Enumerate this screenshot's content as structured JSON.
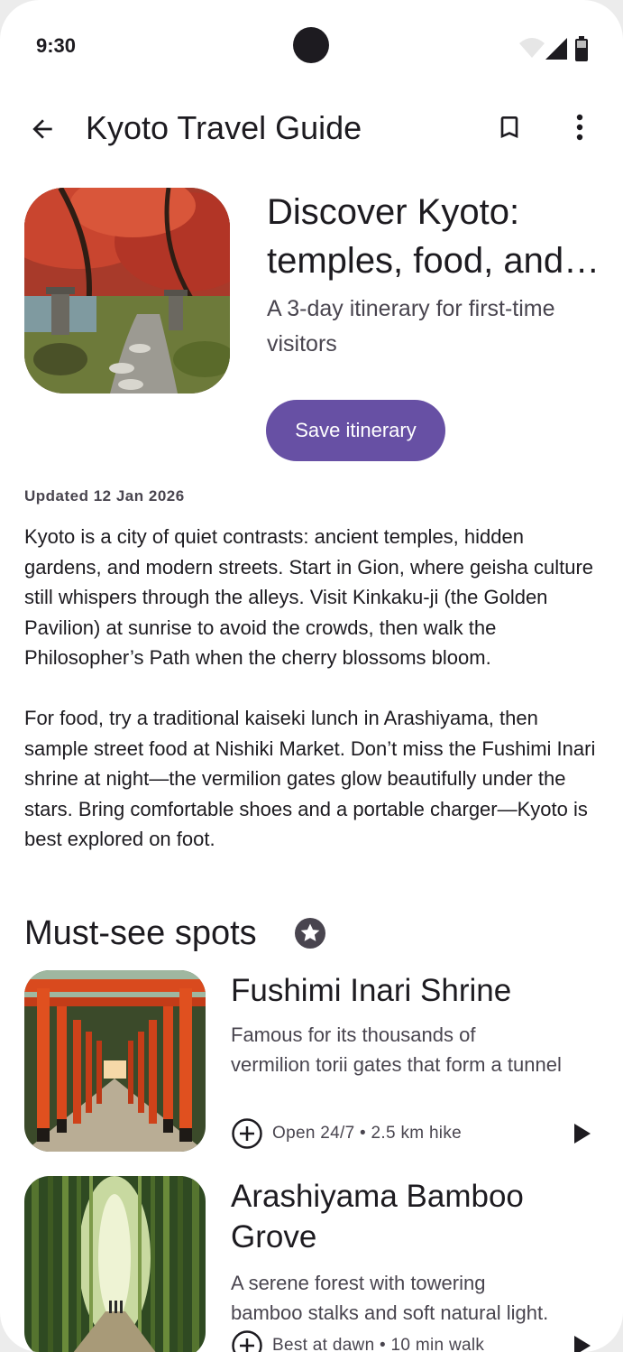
{
  "status_bar": {
    "time": "9:30"
  },
  "app_bar": {
    "title": "Kyoto Travel Guide",
    "back_icon": "arrow-back-icon",
    "bookmark_icon": "bookmark-outline-icon",
    "more_icon": "more-vert-icon"
  },
  "hero": {
    "title_line1": "Discover Kyoto:",
    "title_line2": "temples, food, and more",
    "subtitle": "A 3-day itinerary for first-time visitors",
    "save_button": "Save itinerary"
  },
  "article": {
    "updated": "Updated 12 Jan 2026",
    "paragraph1": "Kyoto is a city of quiet contrasts: ancient temples, hidden gardens, and modern streets. Start in Gion, where geisha culture still whispers through the alleys. Visit Kinkaku-ji (the Golden Pavilion) at sunrise to avoid the crowds, then walk the Philosopher’s Path when the cherry blossoms bloom.",
    "paragraph2": "For food, try a traditional kaiseki lunch in Arashiyama, then sample street food at Nishiki Market. Don’t miss the Fushimi Inari shrine at night—the vermilion gates glow beautifully under the stars. Bring comfortable shoes and a portable charger—Kyoto is best explored on foot."
  },
  "spots_section": {
    "title": "Must-see spots",
    "icon": "star-circle-icon",
    "items": [
      {
        "title": "Fushimi Inari Shrine",
        "desc_line1": "Famous for its thousands of",
        "desc_line2": "vermilion torii gates that form a tunnel",
        "meta": "Open 24/7 • 2.5 km hike"
      },
      {
        "title": "Arashiyama Bamboo Grove",
        "desc_line1": "A serene forest with towering",
        "desc_line2": "bamboo stalks and soft natural light.",
        "meta": "Best at dawn • 10 min walk"
      }
    ]
  },
  "colors": {
    "primary": "#6750a4",
    "on_surface": "#1d1b20",
    "on_surface_variant": "#49454f"
  }
}
